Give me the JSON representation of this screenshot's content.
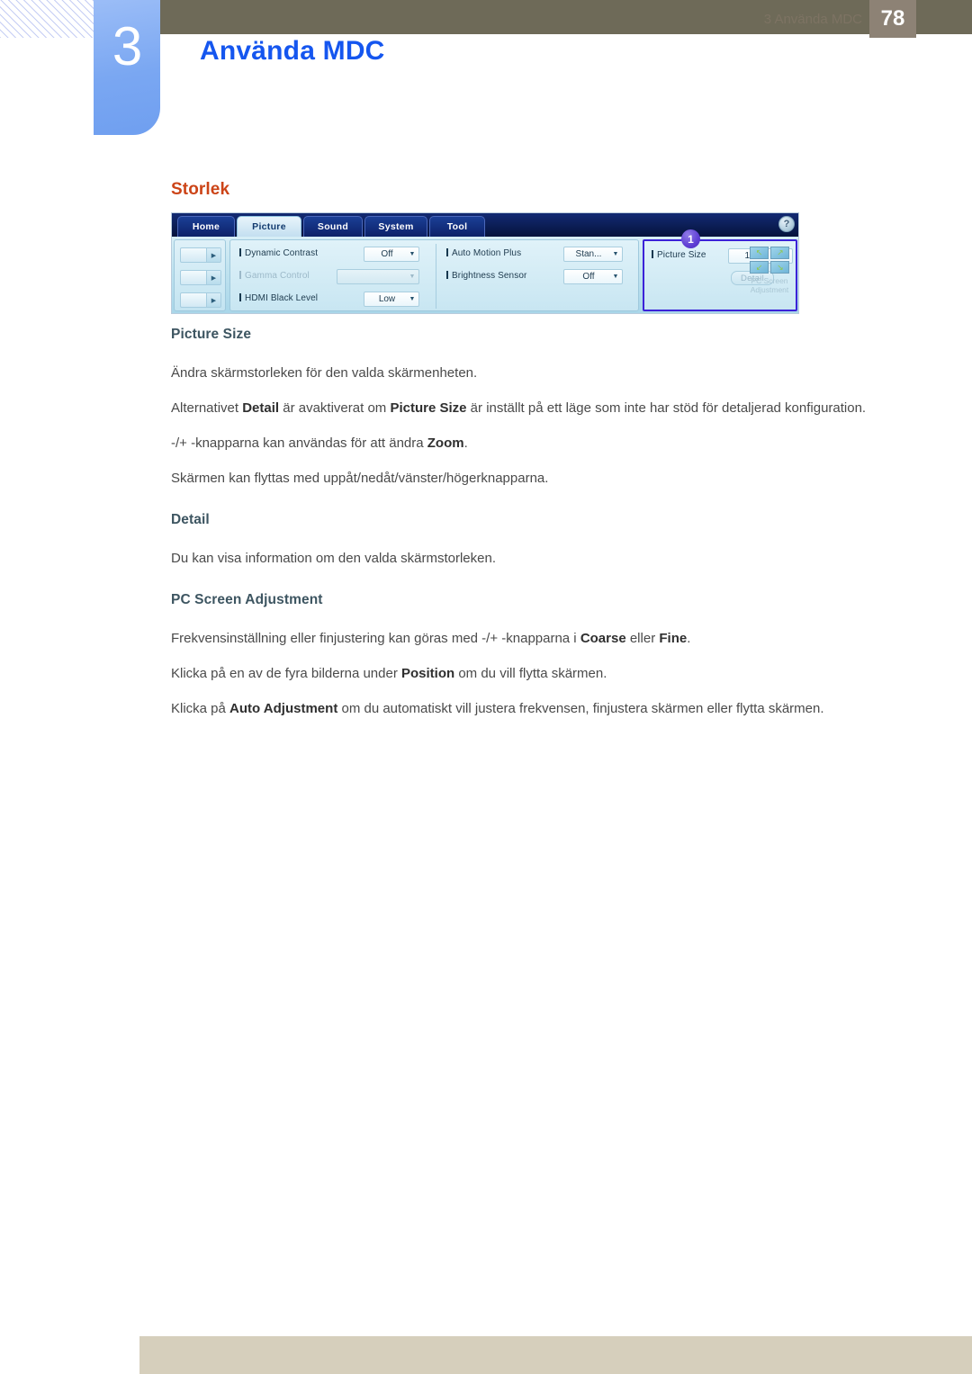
{
  "header": {
    "chapter_number": "3",
    "chapter_title": "Använda MDC"
  },
  "section": {
    "title": "Storlek"
  },
  "ui_figure": {
    "tabs": [
      {
        "label": "Home",
        "active": false
      },
      {
        "label": "Picture",
        "active": true
      },
      {
        "label": "Sound",
        "active": false
      },
      {
        "label": "System",
        "active": false
      },
      {
        "label": "Tool",
        "active": false
      }
    ],
    "help_icon": "?",
    "callout_badge": "1",
    "controls_middle": [
      {
        "label": "Dynamic Contrast",
        "value": "Off",
        "disabled": false
      },
      {
        "label": "Gamma Control",
        "value": "",
        "disabled": true
      },
      {
        "label": "HDMI Black Level",
        "value": "Low",
        "disabled": false
      },
      {
        "label": "Auto Motion Plus",
        "value": "Stan...",
        "disabled": false
      },
      {
        "label": "Brightness Sensor",
        "value": "Off",
        "disabled": false
      }
    ],
    "controls_right": {
      "picture_size_label": "Picture Size",
      "picture_size_value": "16 : 9",
      "detail_button": "Detail",
      "pc_screen_adjustment_line1": "PC Screen",
      "pc_screen_adjustment_line2": "Adjustment",
      "arrow_glyph": "↖"
    },
    "caret_glyph": "▼",
    "stepper_glyph": "▶",
    "accent_color": "#3b22d8",
    "badge_color": "#5f3fd4"
  },
  "body": {
    "h_picture_size": "Picture Size",
    "p1": "Ändra skärmstorleken för den valda skärmenheten.",
    "p2_a": "Alternativet ",
    "p2_b1": "Detail",
    "p2_c": " är avaktiverat om ",
    "p2_b2": "Picture Size",
    "p2_d": " är inställt på ett läge som inte har stöd för detaljerad konfiguration.",
    "p3_a": "-/+ -knapparna kan användas för att ändra ",
    "p3_b": "Zoom",
    "p3_c": ".",
    "p4": "Skärmen kan flyttas med uppåt/nedåt/vänster/högerknapparna.",
    "h_detail": "Detail",
    "p5": "Du kan visa information om den valda skärmstorleken.",
    "h_pcsa": "PC Screen Adjustment",
    "p6_a": "Frekvensinställning eller finjustering kan göras med -/+ -knapparna i ",
    "p6_b1": "Coarse",
    "p6_c": " eller ",
    "p6_b2": "Fine",
    "p6_d": ".",
    "p7_a": "Klicka på en av de fyra bilderna under ",
    "p7_b": "Position",
    "p7_c": " om du vill flytta skärmen.",
    "p8_a": "Klicka på ",
    "p8_b": "Auto Adjustment",
    "p8_c": " om du automatiskt vill justera frekvensen, finjustera skärmen eller flytta skärmen."
  },
  "footer": {
    "text": "3 Använda MDC",
    "page_number": "78"
  }
}
